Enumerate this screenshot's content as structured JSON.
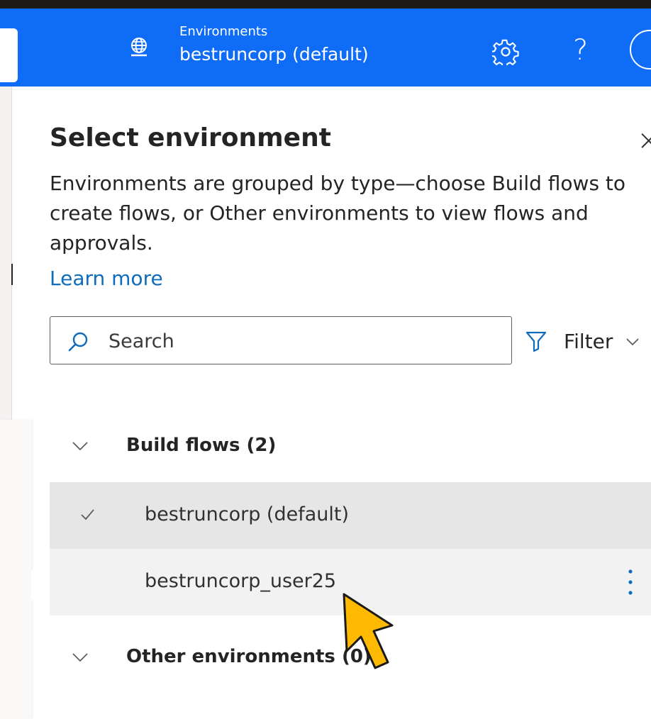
{
  "header": {
    "environments_label": "Environments",
    "current_environment": "bestruncorp (default)",
    "help_glyph": "?",
    "icons": [
      "globe-icon",
      "gear-icon",
      "help-icon",
      "avatar"
    ],
    "accent_color": "#0f6cf6"
  },
  "panel": {
    "title": "Select environment",
    "close_glyph": "×",
    "description": "Environments are grouped by type—choose Build flows to create flows, or Other environments to view flows and approvals.",
    "learn_more": "Learn more"
  },
  "search": {
    "placeholder": "Search",
    "value": ""
  },
  "filter": {
    "label": "Filter"
  },
  "groups": [
    {
      "label": "Build flows (2)",
      "expanded": true,
      "items": [
        {
          "label": "bestruncorp (default)",
          "selected": true
        },
        {
          "label": "bestruncorp_user25",
          "hovered": true
        }
      ]
    },
    {
      "label": "Other environments (0)",
      "expanded": true,
      "items": []
    }
  ]
}
